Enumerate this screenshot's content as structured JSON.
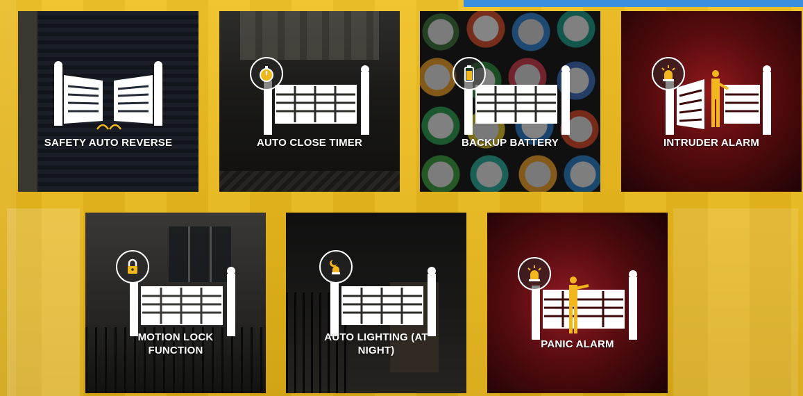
{
  "colors": {
    "background": "#e8b81f",
    "accent_bar": "#3a8fde",
    "icon_white": "#ffffff",
    "icon_yellow": "#f2b71c"
  },
  "features": [
    {
      "label": "SAFETY AUTO REVERSE",
      "icon": "swing-gate-reverse-icon"
    },
    {
      "label": "AUTO CLOSE TIMER",
      "icon": "stopwatch-icon"
    },
    {
      "label": "BACKUP BATTERY",
      "icon": "battery-icon"
    },
    {
      "label": "INTRUDER ALARM",
      "icon": "siren-icon"
    },
    {
      "label": "MOTION LOCK FUNCTION",
      "icon": "padlock-icon"
    },
    {
      "label": "AUTO LIGHTING (AT NIGHT)",
      "icon": "night-lamp-icon"
    },
    {
      "label": "PANIC ALARM",
      "icon": "siren-icon"
    }
  ]
}
